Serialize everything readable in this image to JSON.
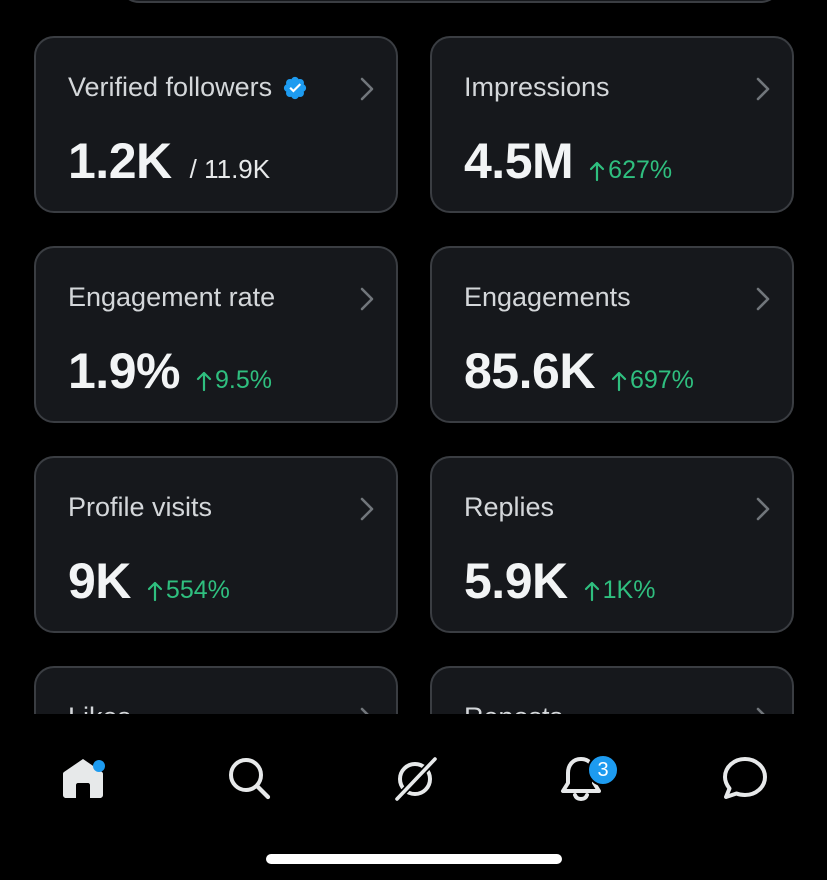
{
  "cards": [
    {
      "label": "Verified followers",
      "value": "1.2K",
      "total": "/ 11.9K",
      "change": null,
      "verified_badge": true
    },
    {
      "label": "Impressions",
      "value": "4.5M",
      "change": "627%"
    },
    {
      "label": "Engagement rate",
      "value": "1.9%",
      "change": "9.5%"
    },
    {
      "label": "Engagements",
      "value": "85.6K",
      "change": "697%"
    },
    {
      "label": "Profile visits",
      "value": "9K",
      "change": "554%"
    },
    {
      "label": "Replies",
      "value": "5.9K",
      "change": "1K%"
    },
    {
      "label": "Likes"
    },
    {
      "label": "Reposts"
    }
  ],
  "tabbar": {
    "items": [
      {
        "name": "home",
        "icon": "home-icon",
        "active": true,
        "has_dot": true
      },
      {
        "name": "search",
        "icon": "search-icon"
      },
      {
        "name": "grok",
        "icon": "grok-icon"
      },
      {
        "name": "notifications",
        "icon": "bell-icon",
        "badge": "3"
      },
      {
        "name": "messages",
        "icon": "message-icon"
      }
    ]
  },
  "colors": {
    "background": "#000000",
    "card_background": "#16181c",
    "card_border": "#3a3d42",
    "positive": "#2fbf7f",
    "accent": "#1d9bf0"
  }
}
